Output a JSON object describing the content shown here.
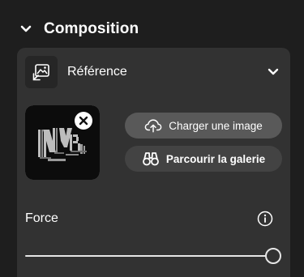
{
  "section": {
    "title": "Composition",
    "expanded": true
  },
  "reference": {
    "label": "Référence",
    "thumbnail_close_icon": "close-icon"
  },
  "buttons": {
    "upload_label": "Charger une image",
    "upload_icon": "cloud-upload-icon",
    "gallery_label": "Parcourir la galerie",
    "gallery_icon": "binoculars-icon"
  },
  "force": {
    "label": "Force",
    "info_icon": "info-icon",
    "value": 1.0
  },
  "colors": {
    "background": "#1e1e1e",
    "panel": "#323232",
    "upload_button": "#595959",
    "gallery_button": "#434343",
    "text": "#ffffff"
  }
}
